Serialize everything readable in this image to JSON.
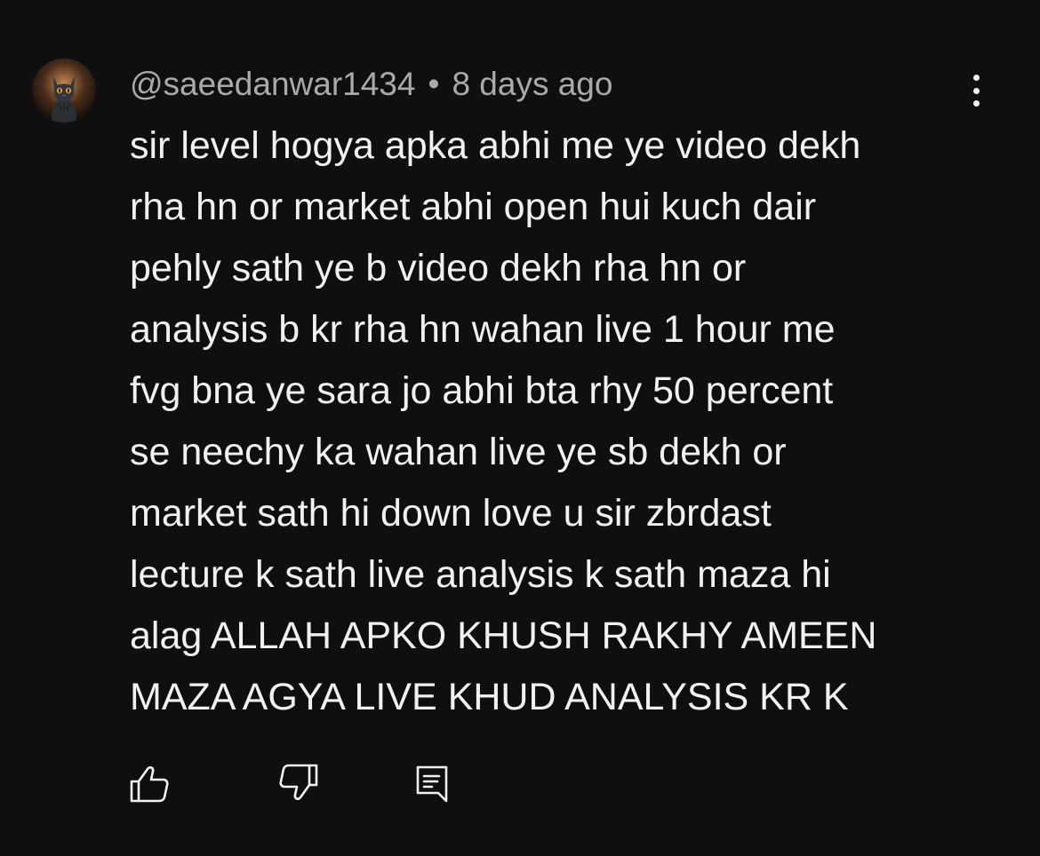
{
  "comment": {
    "author": "@saeedanwar1434",
    "separator": "•",
    "timestamp": "8 days ago",
    "avatar_icon": "cat-avatar",
    "lines": [
      "sir level hogya apka abhi me ye video dekh",
      "rha hn or market abhi open hui kuch dair",
      "pehly sath ye b video dekh rha hn or",
      "analysis b kr rha hn wahan live 1 hour me",
      "fvg bna ye sara jo abhi bta rhy 50 percent",
      "se neechy ka wahan live ye sb dekh or",
      "market sath hi down love u sir zbrdast",
      "lecture k sath live analysis k sath maza hi",
      "alag ALLAH APKO KHUSH RAKHY AMEEN",
      "MAZA AGYA LIVE KHUD ANALYSIS KR K"
    ]
  },
  "actions": {
    "like_icon": "thumbs-up-icon",
    "dislike_icon": "thumbs-down-icon",
    "reply_icon": "reply-comment-icon",
    "more_icon": "more-vertical-icon"
  },
  "colors": {
    "background": "#0f0f0f",
    "text_primary": "#f1f1f1",
    "text_secondary": "#aaaaaa"
  }
}
